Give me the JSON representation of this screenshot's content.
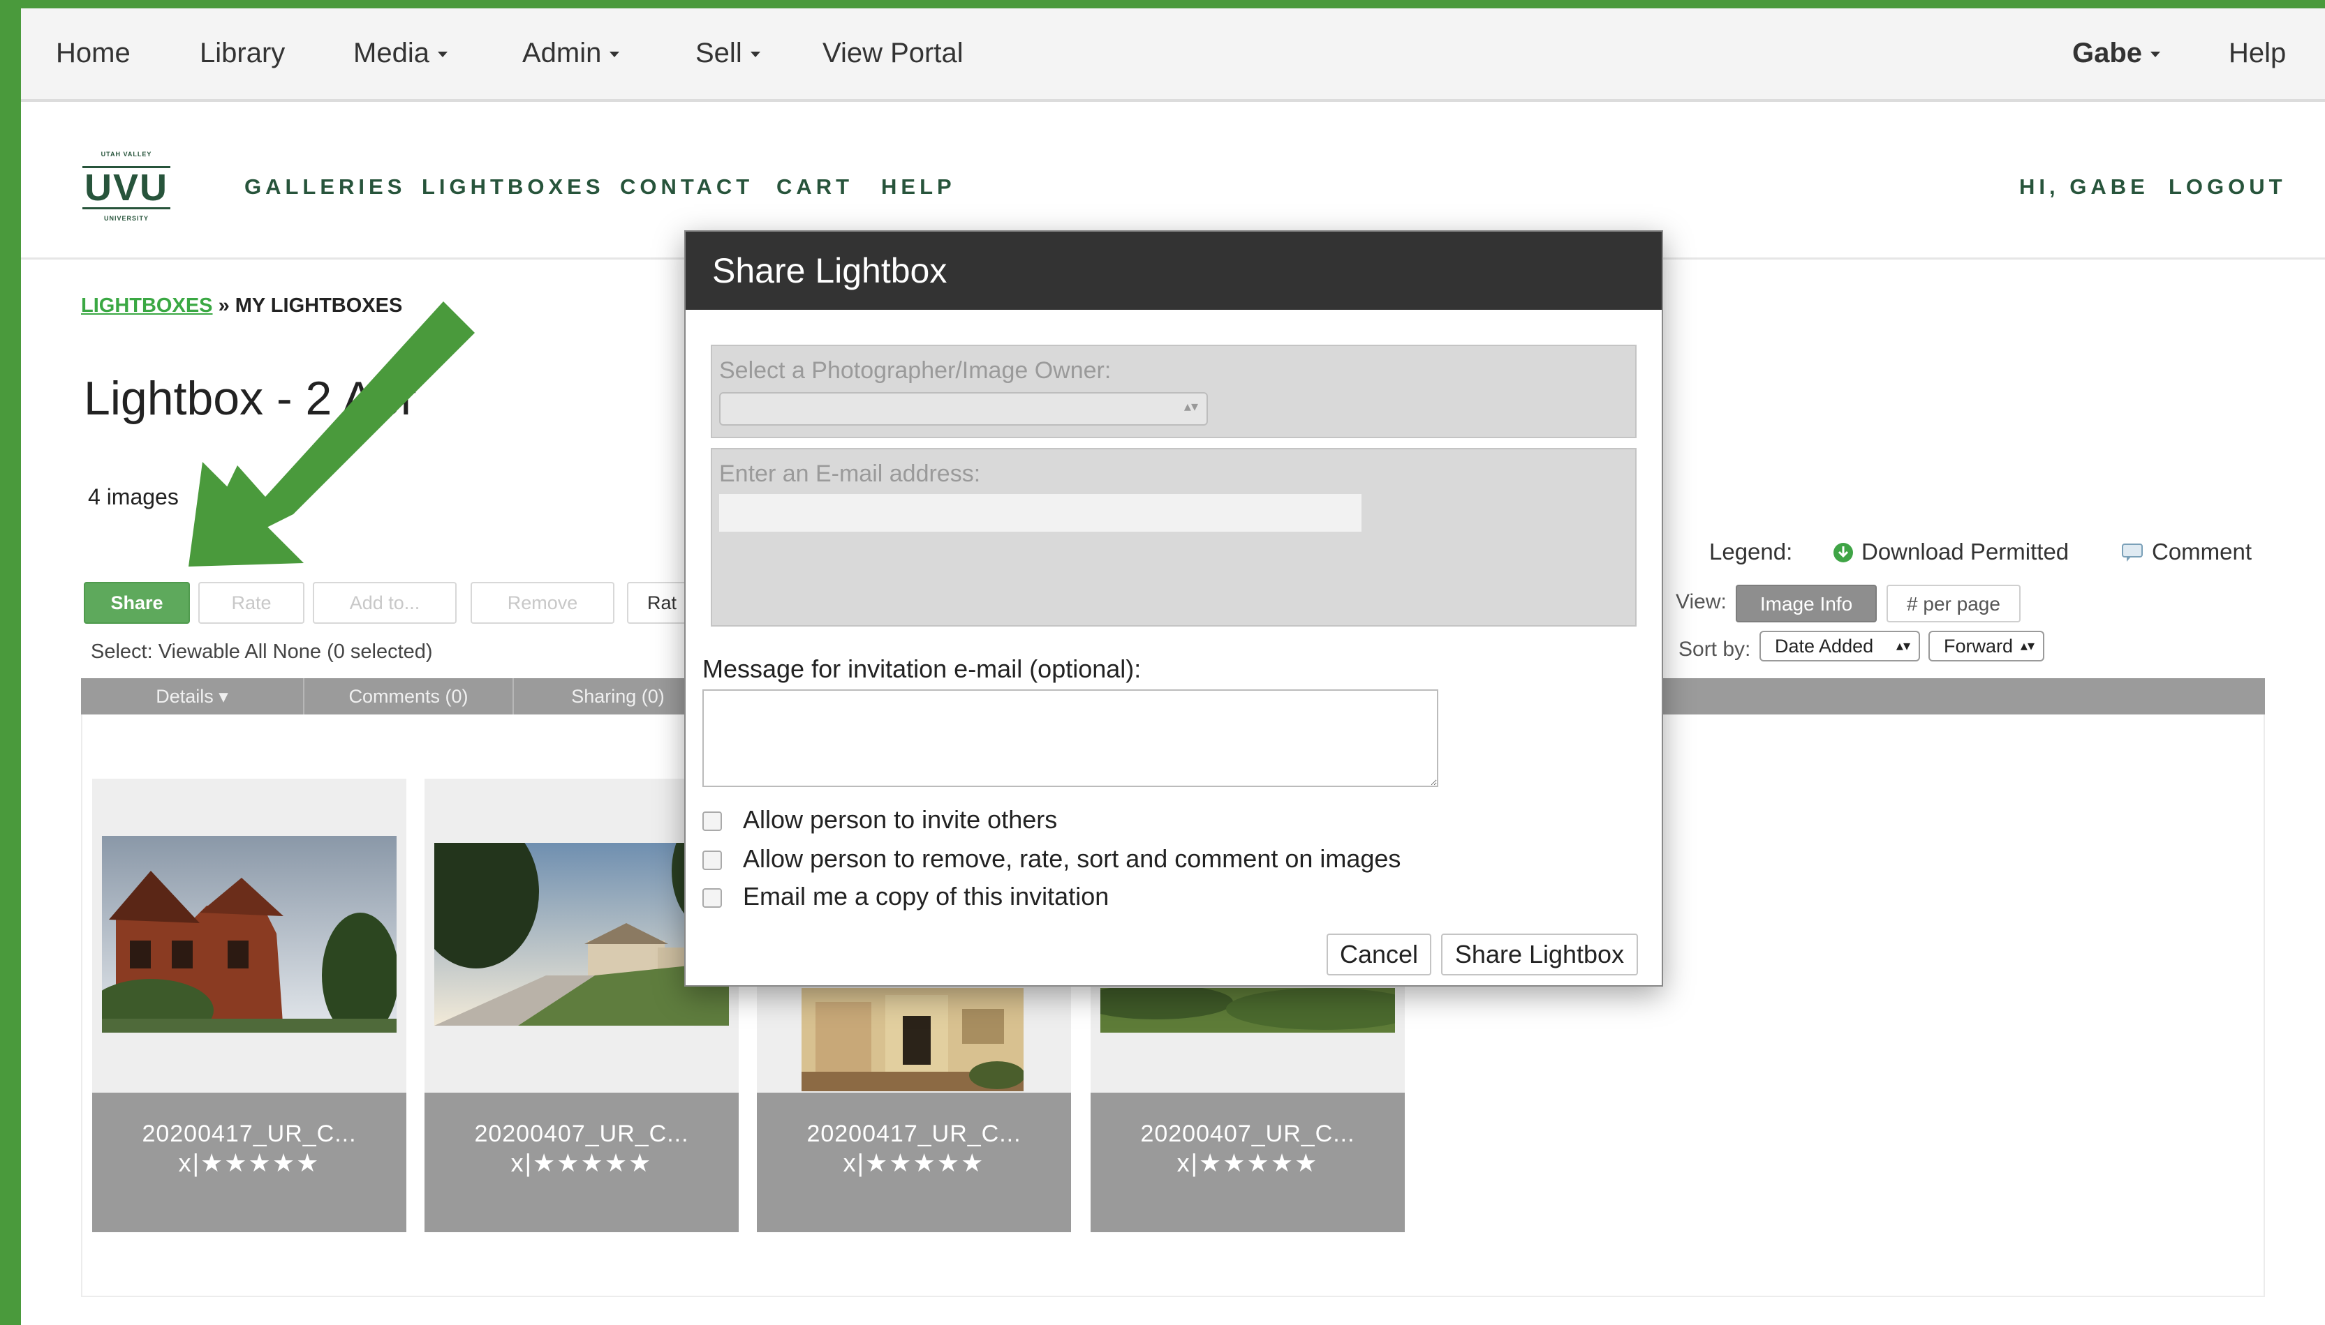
{
  "adminbar": {
    "home": "Home",
    "library": "Library",
    "media": "Media",
    "admin": "Admin",
    "sell": "Sell",
    "view_portal": "View Portal",
    "user": "Gabe",
    "help": "Help"
  },
  "site": {
    "logo_top": "UTAH VALLEY",
    "logo_main": "UVU",
    "logo_bottom": "UNIVERSITY",
    "nav": [
      "GALLERIES",
      "LIGHTBOXES",
      "CONTACT",
      "CART",
      "HELP"
    ],
    "greeting": "HI, GABE",
    "logout": "LOGOUT"
  },
  "page": {
    "breadcrumb_link": "LIGHTBOXES",
    "breadcrumb_sep": " » ",
    "breadcrumb_current": "MY LIGHTBOXES",
    "title": "Lightbox - 2 Apr",
    "image_count": "4 images"
  },
  "toolbar": {
    "share": "Share",
    "rate": "Rate",
    "add_to": "Add to...",
    "remove": "Remove",
    "rate2": "Rat",
    "select_label": "Select:",
    "select_viewable": "Viewable",
    "select_all": "All",
    "select_none": "None",
    "selected_count": "(0 selected)"
  },
  "tabs": [
    "Details ▾",
    "Comments (0)",
    "Sharing (0)"
  ],
  "legend": {
    "label": "Legend:",
    "download": "Download Permitted",
    "comment": "Comment"
  },
  "view": {
    "label": "View:",
    "image_info": "Image Info",
    "per_page": "# per page",
    "sort_label": "Sort by:",
    "sort_value": "Date Added",
    "order_value": "Forward"
  },
  "images": [
    {
      "filename": "20200417_UR_C...",
      "stars": "x|★★★★★"
    },
    {
      "filename": "20200407_UR_C...",
      "stars": "x|★★★★★"
    },
    {
      "filename": "20200417_UR_C...",
      "stars": "x|★★★★★"
    },
    {
      "filename": "20200407_UR_C...",
      "stars": "x|★★★★★"
    }
  ],
  "modal": {
    "title": "Share Lightbox",
    "owner_label": "Select a Photographer/Image Owner:",
    "email_label": "Enter an E-mail address:",
    "message_label": "Message for invitation e-mail (optional):",
    "opt_invite": "Allow person to invite others",
    "opt_remove": "Allow person to remove, rate, sort and comment on images",
    "opt_copy": "Email me a copy of this invitation",
    "cancel": "Cancel",
    "submit": "Share Lightbox"
  },
  "colors": {
    "brand_green": "#27543b",
    "accent_green": "#4a9a3c",
    "modal_header": "#333333"
  }
}
